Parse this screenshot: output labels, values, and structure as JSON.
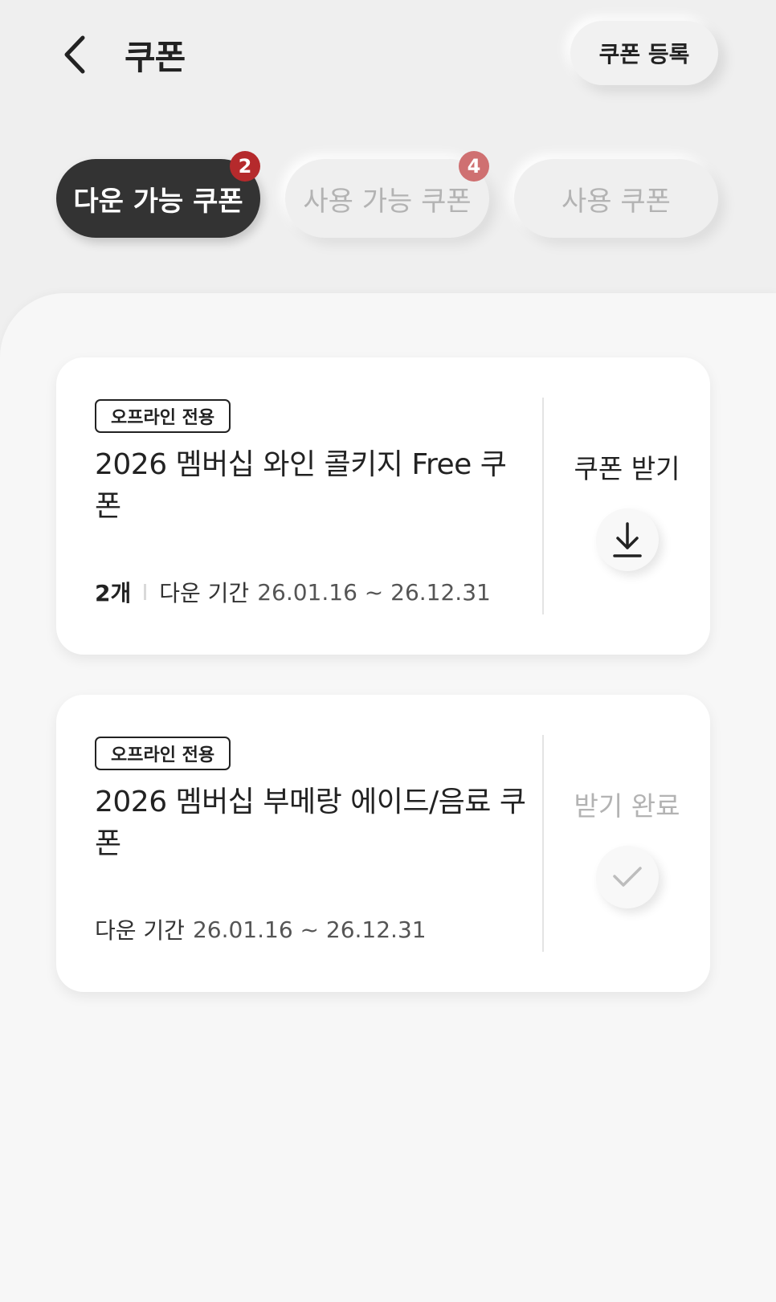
{
  "header": {
    "title": "쿠폰",
    "register_label": "쿠폰 등록"
  },
  "tabs": [
    {
      "label": "다운 가능 쿠폰",
      "badge": "2",
      "active": true
    },
    {
      "label": "사용 가능 쿠폰",
      "badge": "4",
      "active": false
    },
    {
      "label": "사용 쿠폰",
      "active": false
    }
  ],
  "coupons": [
    {
      "tag": "오프라인 전용",
      "title": "2026 멤버십 와인 콜키지 Free 쿠폰",
      "count": "2개",
      "period_label": "다운 기간",
      "period": "26.01.16 ~ 26.12.31",
      "action_label": "쿠폰 받기",
      "action_icon": "download-icon"
    },
    {
      "tag": "오프라인 전용",
      "title": "2026 멤버십 부메랑 에이드/음료 쿠폰",
      "period_label": "다운 기간",
      "period": "26.01.16 ~ 26.12.31",
      "action_label": "받기 완료",
      "action_icon": "check-icon"
    }
  ],
  "colors": {
    "background": "#efefef",
    "active_tab": "#333333",
    "badge_primary": "#b52a2c",
    "badge_secondary": "#cf7071",
    "text_primary": "#222222",
    "text_muted": "#b3b3b3"
  }
}
